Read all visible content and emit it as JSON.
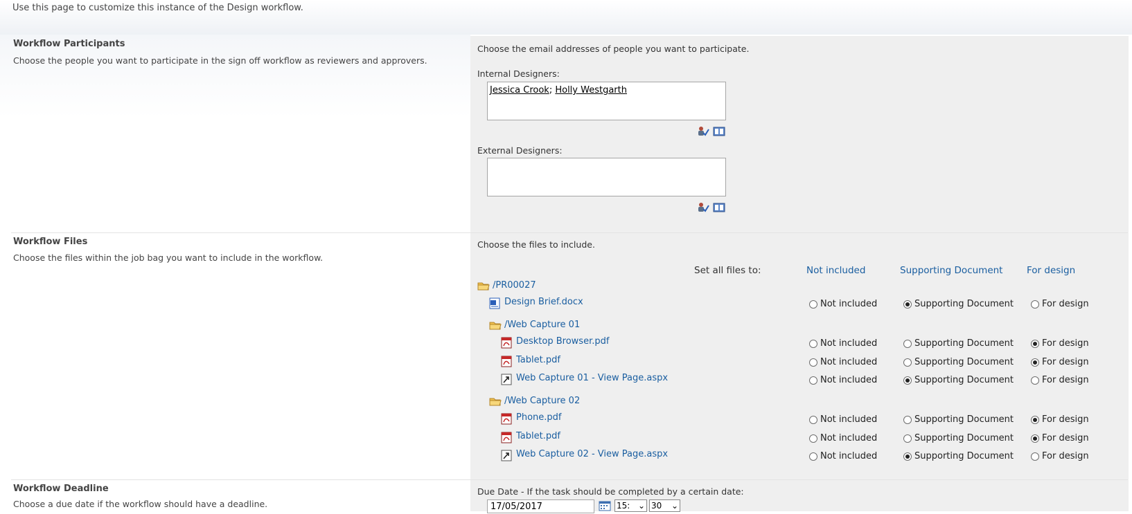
{
  "intro_text": "Use this page to customize this instance of the Design workflow.",
  "participants": {
    "title": "Workflow Participants",
    "description": "Choose the people you want to participate in the sign off workflow as reviewers and approvers.",
    "instructions": "Choose the email addresses of people you want to participate.",
    "internal_label": "Internal Designers:",
    "internal_people": [
      "Jessica Crook",
      "Holly Westgarth"
    ],
    "separator": ";",
    "external_label": "External Designers:",
    "external_people": []
  },
  "files": {
    "title": "Workflow Files",
    "description": "Choose the files within the job bag you want to include in the workflow.",
    "instructions": "Choose the files to include.",
    "set_all_label": "Set all files to:",
    "set_all_options": [
      "Not included",
      "Supporting Document",
      "For design"
    ],
    "option_labels": [
      "Not included",
      "Supporting Document",
      "For design"
    ],
    "tree": [
      {
        "kind": "folder",
        "name": "/PR00027",
        "level": 0
      },
      {
        "kind": "file",
        "type": "docx",
        "name": "Design Brief.docx",
        "level": 1,
        "selected": 1
      },
      {
        "kind": "folder",
        "name": "/Web Capture 01",
        "level": 1
      },
      {
        "kind": "file",
        "type": "pdf",
        "name": "Desktop Browser.pdf",
        "level": 2,
        "selected": 2
      },
      {
        "kind": "file",
        "type": "pdf",
        "name": "Tablet.pdf",
        "level": 2,
        "selected": 2
      },
      {
        "kind": "file",
        "type": "link",
        "name": "Web Capture 01 - View Page.aspx",
        "level": 2,
        "selected": 1
      },
      {
        "kind": "folder",
        "name": "/Web Capture 02",
        "level": 1
      },
      {
        "kind": "file",
        "type": "pdf",
        "name": "Phone.pdf",
        "level": 2,
        "selected": 2
      },
      {
        "kind": "file",
        "type": "pdf",
        "name": "Tablet.pdf",
        "level": 2,
        "selected": 2
      },
      {
        "kind": "file",
        "type": "link",
        "name": "Web Capture 02 - View Page.aspx",
        "level": 2,
        "selected": 1
      }
    ]
  },
  "deadline": {
    "title": "Workflow Deadline",
    "description": "Choose a due date if the workflow should have a deadline.",
    "due_label": "Due Date - If the task should be completed by a certain date:",
    "date_value": "17/05/2017",
    "hour_value": "15:",
    "minute_value": "30"
  },
  "colors": {
    "link": "#1a5ea0",
    "panel": "#efefef"
  }
}
